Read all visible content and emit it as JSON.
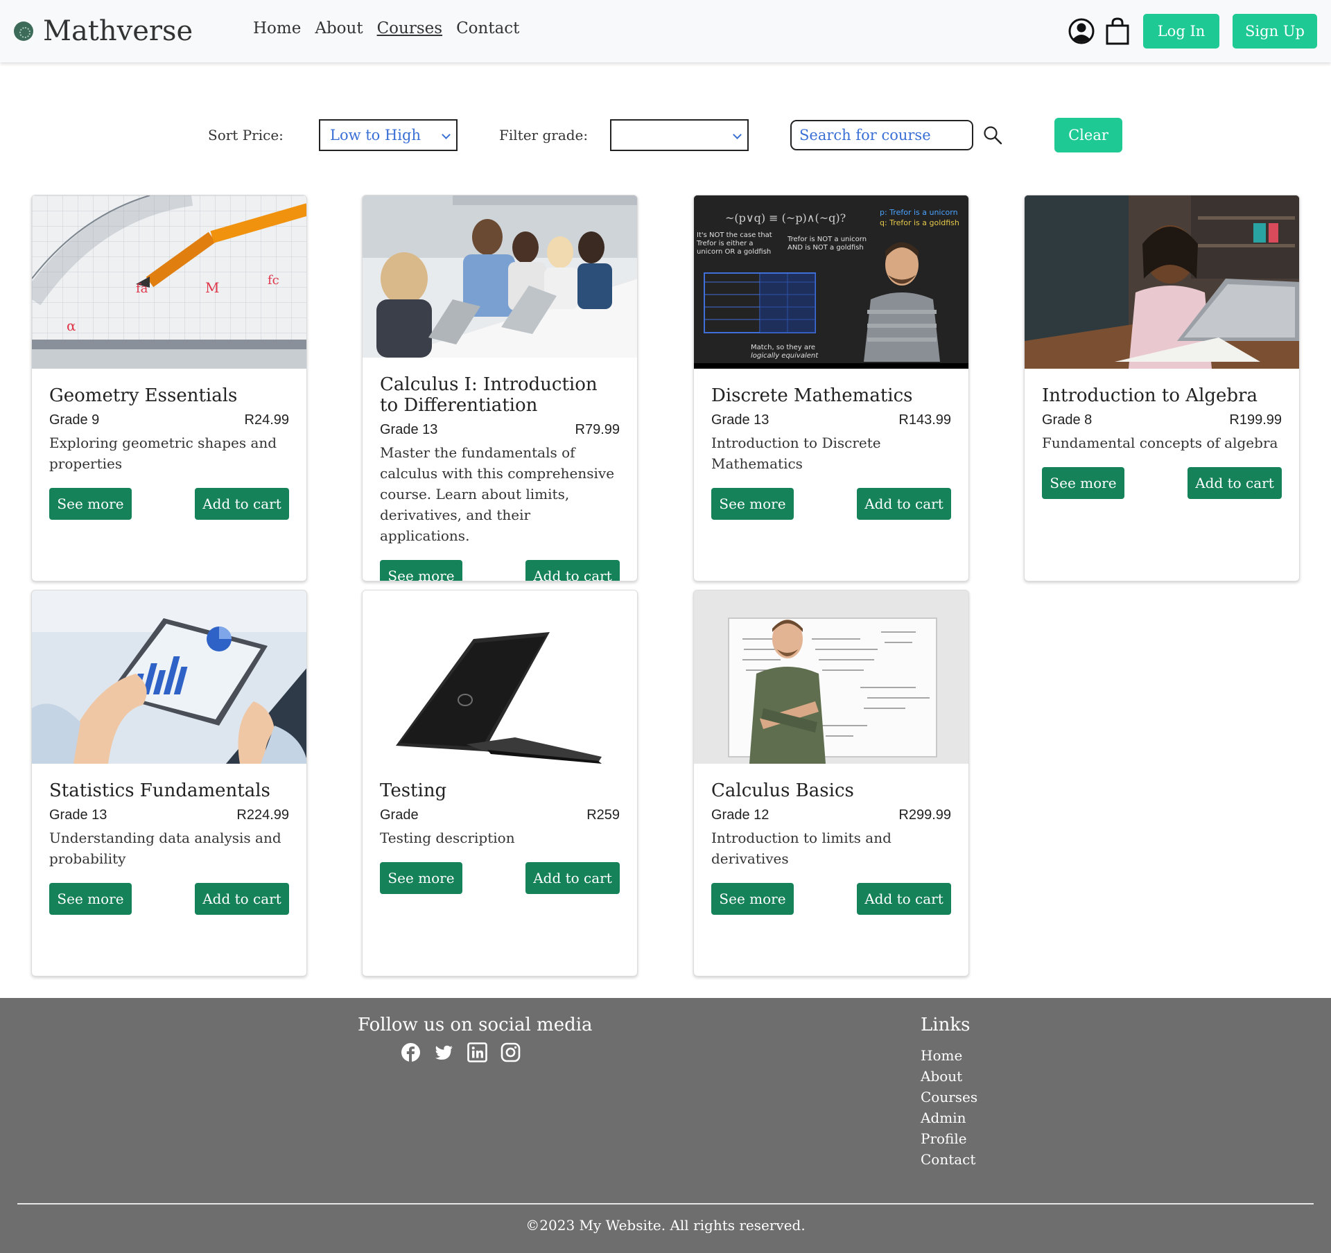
{
  "brand": {
    "name": "Mathverse"
  },
  "nav": [
    {
      "label": "Home",
      "active": false
    },
    {
      "label": "About",
      "active": false
    },
    {
      "label": "Courses",
      "active": true
    },
    {
      "label": "Contact",
      "active": false
    }
  ],
  "header": {
    "login_label": "Log In",
    "signup_label": "Sign Up",
    "user_icon": "user-circle-icon",
    "cart_icon": "shopping-bag-icon"
  },
  "filters": {
    "sort_label": "Sort Price:",
    "sort_value": "Low to High",
    "grade_label": "Filter grade:",
    "grade_value": "",
    "search_placeholder": "Search for course",
    "clear_label": "Clear"
  },
  "courses": [
    {
      "title": "Geometry Essentials",
      "grade": "Grade 9",
      "price": "R24.99",
      "description": "Exploring geometric shapes and properties"
    },
    {
      "title": "Calculus I: Introduction to Differentiation",
      "grade": "Grade 13",
      "price": "R79.99",
      "description": "Master the fundamentals of calculus with this comprehensive course. Learn about limits, derivatives, and their applications."
    },
    {
      "title": "Discrete Mathematics",
      "grade": "Grade 13",
      "price": "R143.99",
      "description": "Introduction to Discrete Mathematics"
    },
    {
      "title": "Introduction to Algebra",
      "grade": "Grade 8",
      "price": "R199.99",
      "description": "Fundamental concepts of algebra"
    },
    {
      "title": "Statistics Fundamentals",
      "grade": "Grade 13",
      "price": "R224.99",
      "description": "Understanding data analysis and probability"
    },
    {
      "title": "Testing",
      "grade": "Grade",
      "price": "R259",
      "description": "Testing description"
    },
    {
      "title": "Calculus Basics",
      "grade": "Grade 12",
      "price": "R299.99",
      "description": "Introduction to limits and derivatives"
    }
  ],
  "card_buttons": {
    "see_more": "See more",
    "add_to_cart": "Add to cart"
  },
  "footer": {
    "follow_label": "Follow us on social media",
    "social_icons": [
      "facebook-icon",
      "twitter-icon",
      "linkedin-icon",
      "instagram-icon"
    ],
    "links_title": "Links",
    "links": [
      "Home",
      "About",
      "Courses",
      "Admin",
      "Profile",
      "Contact"
    ],
    "copyright": "©2023 My Website. All rights reserved."
  },
  "colors": {
    "accent": "#1ec994",
    "card_button": "#16825a",
    "footer_bg": "#6e6e6e",
    "header_bg": "#f8f9fa"
  }
}
